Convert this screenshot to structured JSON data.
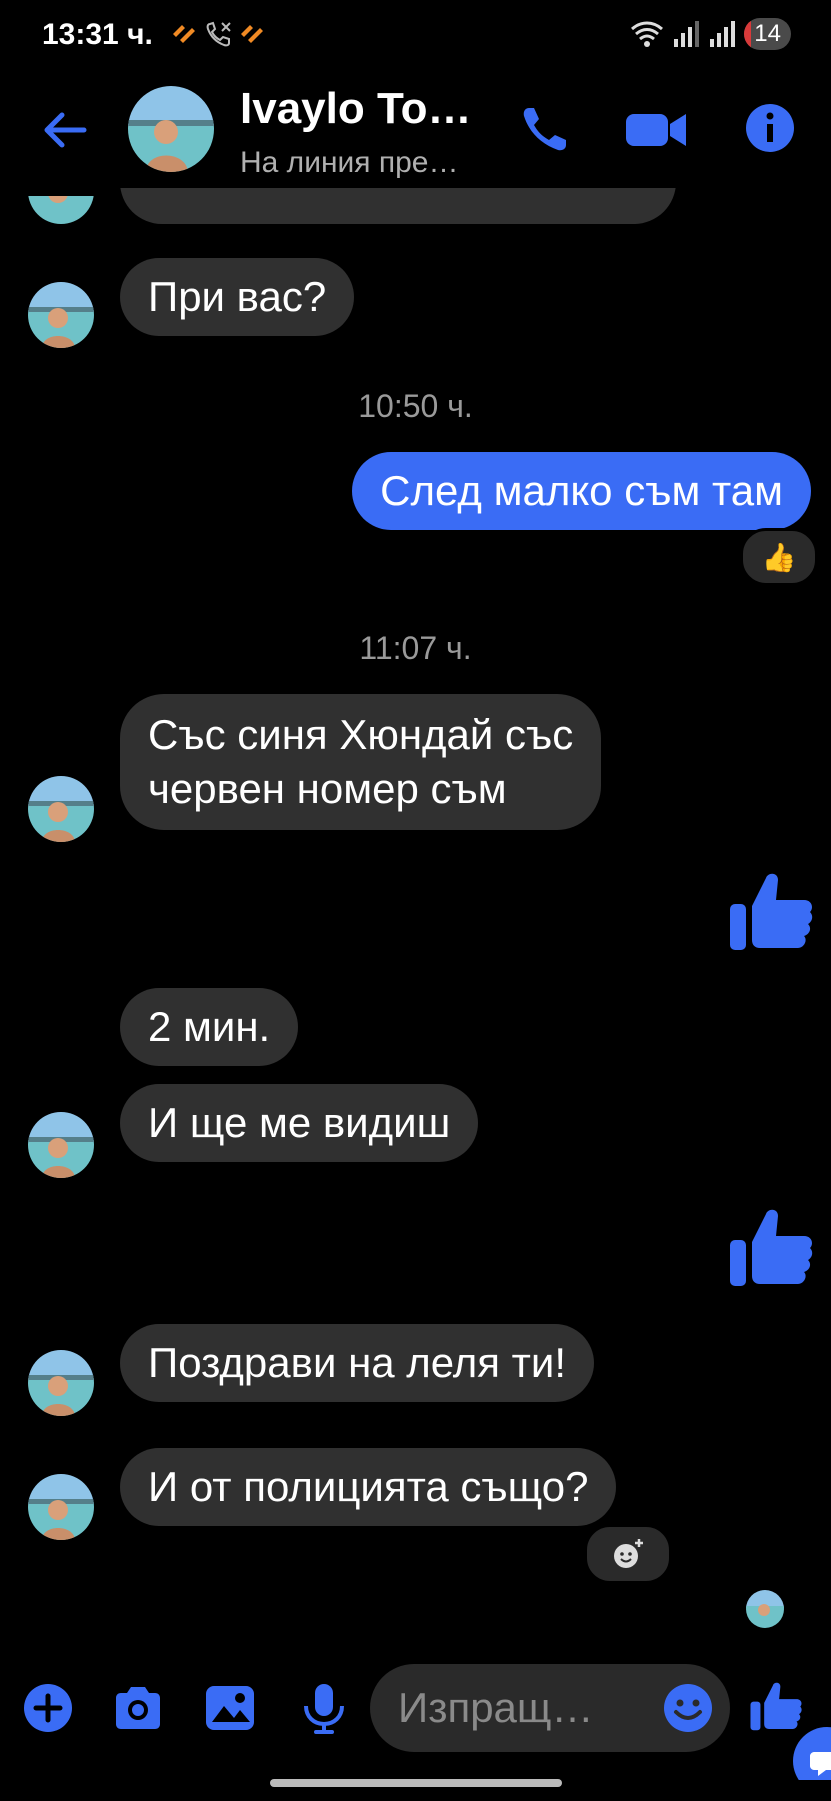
{
  "status_bar": {
    "time": "13:31 ч.",
    "battery": "14",
    "battery_color": "#d83a3a"
  },
  "header": {
    "contact_name": "Ivaylo To…",
    "status": "На линия пре…",
    "icons": [
      "back-arrow-icon",
      "phone-icon",
      "video-camera-icon",
      "info-icon"
    ],
    "accent": "#3a6cf5"
  },
  "messages": [
    {
      "from": "them",
      "text": "При вас?"
    },
    {
      "timestamp": "10:50 ч."
    },
    {
      "from": "me",
      "text": "След малко съм там",
      "reaction": "👍"
    },
    {
      "timestamp": "11:07 ч."
    },
    {
      "from": "them",
      "text_line1": "Със синя Хюндай със",
      "text_line2": "червен номер съм"
    },
    {
      "from": "me",
      "type": "like"
    },
    {
      "from": "them",
      "text": "2 мин."
    },
    {
      "from": "them",
      "text": "И ще ме видиш"
    },
    {
      "from": "me",
      "type": "like"
    },
    {
      "from": "them",
      "text": "Поздрави на леля ти!"
    },
    {
      "from": "them",
      "text": "И от полицията също?"
    }
  ],
  "composer": {
    "placeholder": "Изпращ…",
    "icons": [
      "plus-icon",
      "camera-icon",
      "gallery-icon",
      "microphone-icon",
      "emoji-icon",
      "like-icon"
    ]
  },
  "colors": {
    "bubble_in": "#303030",
    "bubble_out": "#3a6cf5",
    "background": "#000000"
  }
}
